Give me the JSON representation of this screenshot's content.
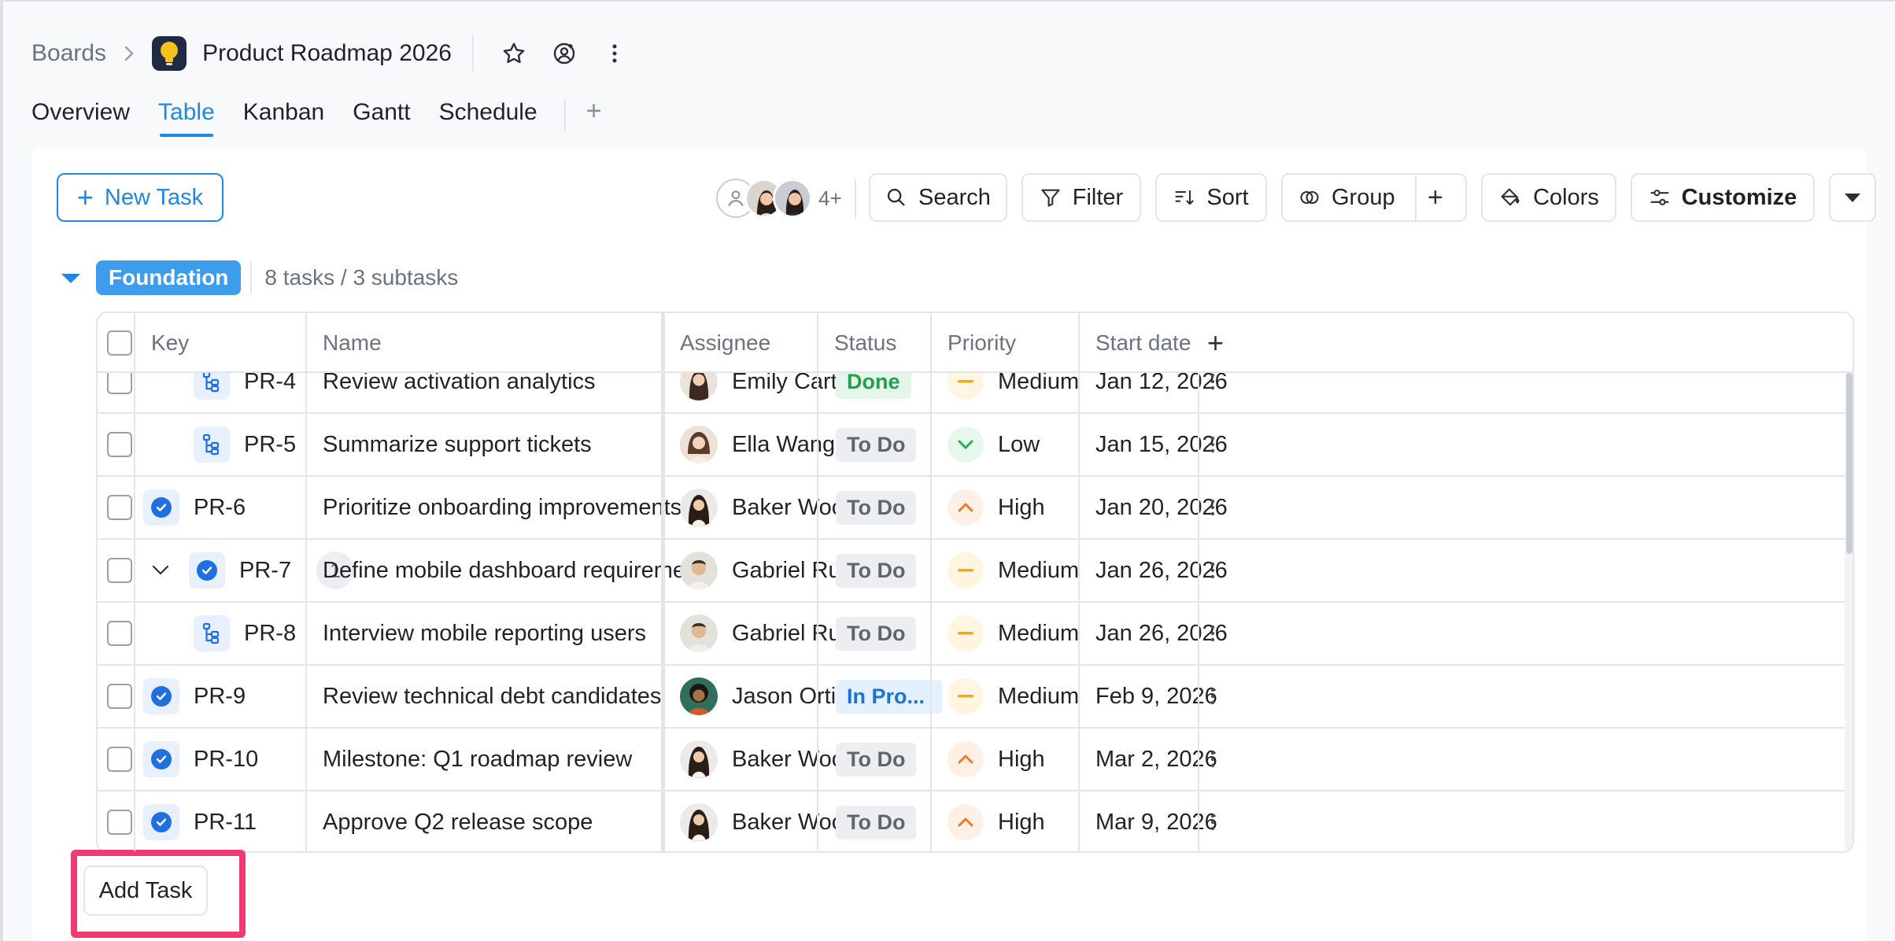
{
  "header": {
    "breadcrumb_root": "Boards",
    "board_title": "Product Roadmap 2026",
    "icons": [
      "star-icon",
      "follow-icon",
      "more-vertical-icon"
    ]
  },
  "tabs": [
    {
      "label": "Overview",
      "active": false
    },
    {
      "label": "Table",
      "active": true
    },
    {
      "label": "Kanban",
      "active": false
    },
    {
      "label": "Gantt",
      "active": false
    },
    {
      "label": "Schedule",
      "active": false
    }
  ],
  "toolbar": {
    "new_task": "New Task",
    "members_more": "4+",
    "search": "Search",
    "filter": "Filter",
    "sort": "Sort",
    "group": "Group",
    "colors": "Colors",
    "customize": "Customize"
  },
  "group": {
    "name": "Foundation",
    "count": "8 tasks / 3 subtasks"
  },
  "columns": {
    "key": "Key",
    "name": "Name",
    "assignee": "Assignee",
    "status": "Status",
    "priority": "Priority",
    "start_date": "Start date"
  },
  "rows": [
    {
      "key": "PR-4",
      "type": "subtask",
      "name": "Review activation analytics",
      "assignee": "Emily Carter",
      "status": "Done",
      "priority": "Medium",
      "start": "Jan 12, 2026"
    },
    {
      "key": "PR-5",
      "type": "subtask",
      "name": "Summarize support tickets",
      "assignee": "Ella Wang",
      "status": "To Do",
      "priority": "Low",
      "start": "Jan 15, 2026"
    },
    {
      "key": "PR-6",
      "type": "task",
      "name": "Prioritize onboarding improvements",
      "assignee": "Baker Wood",
      "status": "To Do",
      "priority": "High",
      "start": "Jan 20, 2026"
    },
    {
      "key": "PR-7",
      "type": "task",
      "expandable": true,
      "subcount": "1",
      "name": "Define mobile dashboard requirements",
      "assignee": "Gabriel Ru...",
      "status": "To Do",
      "priority": "Medium",
      "start": "Jan 26, 2026"
    },
    {
      "key": "PR-8",
      "type": "subtask",
      "name": "Interview mobile reporting users",
      "assignee": "Gabriel Ru...",
      "status": "To Do",
      "priority": "Medium",
      "start": "Jan 26, 2026"
    },
    {
      "key": "PR-9",
      "type": "task",
      "name": "Review technical debt candidates",
      "assignee": "Jason Ortiz",
      "status": "In Pro...",
      "priority": "Medium",
      "start": "Feb 9, 2026"
    },
    {
      "key": "PR-10",
      "type": "task",
      "name": "Milestone: Q1 roadmap review",
      "assignee": "Baker Wood",
      "status": "To Do",
      "priority": "High",
      "start": "Mar 2, 2026"
    },
    {
      "key": "PR-11",
      "type": "task",
      "name": "Approve Q2 release scope",
      "assignee": "Baker Wood",
      "status": "To Do",
      "priority": "High",
      "start": "Mar 9, 2026"
    }
  ],
  "add_task": "Add Task",
  "colors": {
    "accent": "#1e88e5",
    "highlight": "#f03a72"
  }
}
